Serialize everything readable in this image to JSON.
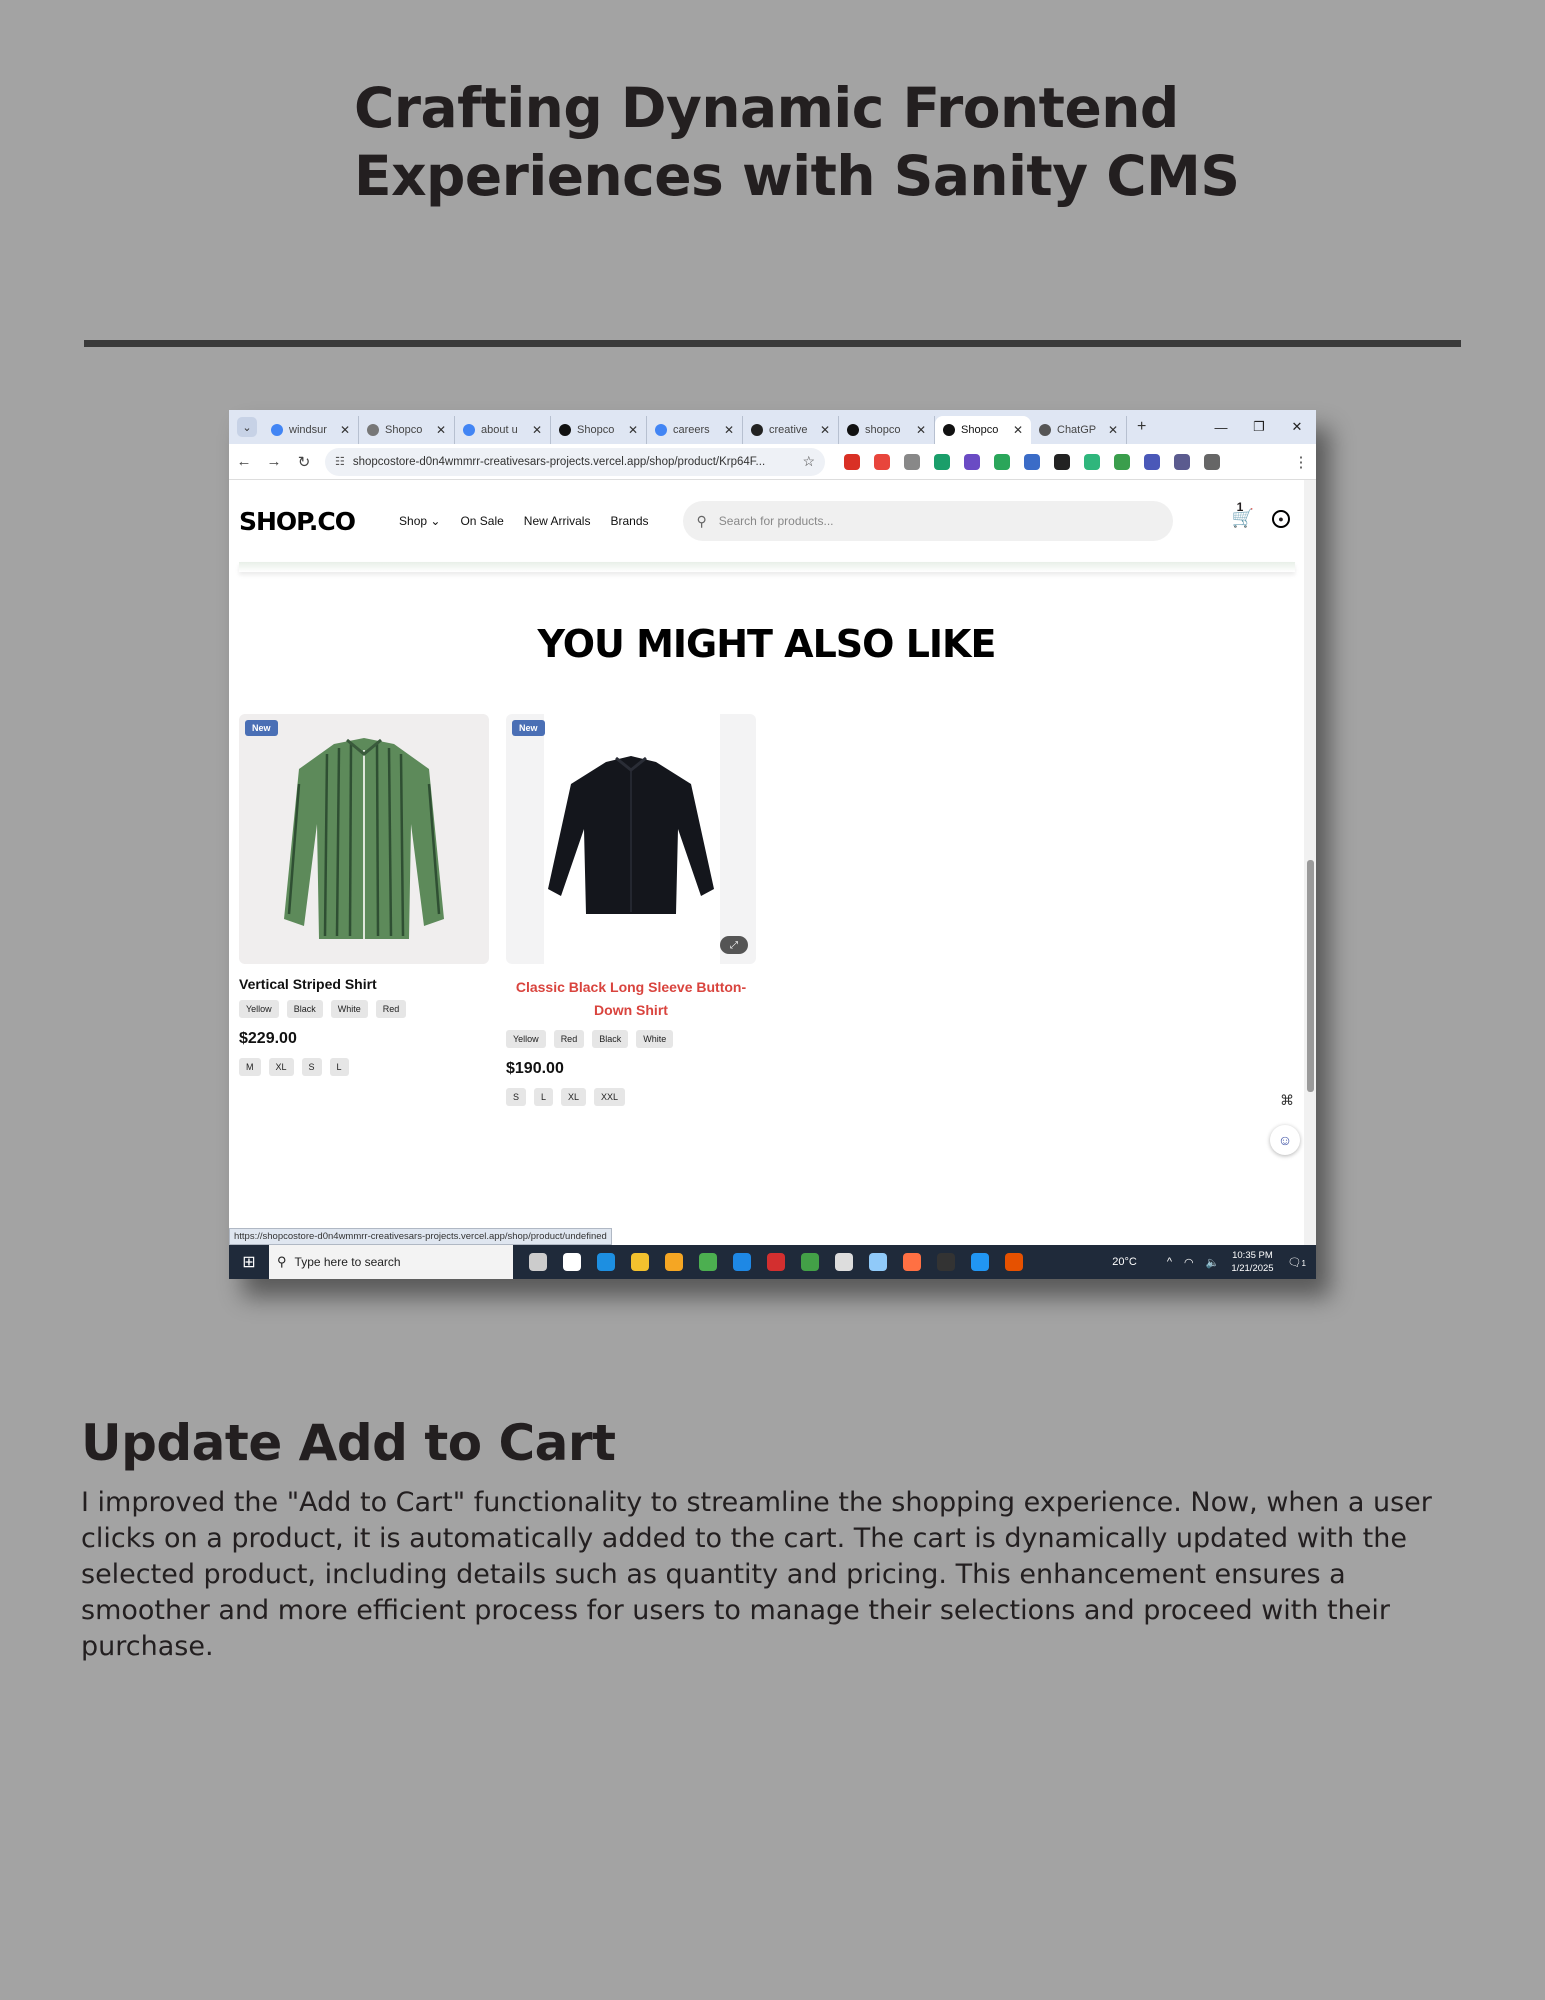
{
  "document": {
    "title_line1": "Crafting Dynamic Frontend",
    "title_line2": "Experiences with Sanity CMS",
    "section_heading": "Update Add to Cart",
    "paragraph": "I improved the \"Add to Cart\" functionality to streamline the shopping experience. Now, when a user clicks on a product, it is automatically added to the cart. The cart is dynamically updated with the selected product, including details such as quantity and pricing. This enhancement ensures a smoother and more efficient process for users to manage their selections and proceed with their purchase."
  },
  "browser": {
    "tabs": [
      {
        "label": "windsur",
        "favicon": "google-icon",
        "color": "#4285f4"
      },
      {
        "label": "Shopco",
        "favicon": "globe-icon",
        "color": "#777777"
      },
      {
        "label": "about u",
        "favicon": "google-icon",
        "color": "#4285f4"
      },
      {
        "label": "Shopco",
        "favicon": "vercel-icon",
        "color": "#111111"
      },
      {
        "label": "careers",
        "favicon": "google-icon",
        "color": "#4285f4"
      },
      {
        "label": "creative",
        "favicon": "github-icon",
        "color": "#222222"
      },
      {
        "label": "shopco",
        "favicon": "vercel-icon",
        "color": "#111111"
      },
      {
        "label": "Shopco",
        "favicon": "vercel-icon",
        "color": "#111111",
        "active": true
      },
      {
        "label": "ChatGP",
        "favicon": "openai-icon",
        "color": "#555555"
      }
    ],
    "new_tab": "+",
    "url": "shopcostore-d0n4wmmrr-creativesars-projects.vercel.app/shop/product/Krp64F...",
    "status_url": "https://shopcostore-d0n4wmmrr-creativesars-projects.vercel.app/shop/product/undefined",
    "extension_colors": [
      "#d93025",
      "#e8453c",
      "#888888",
      "#1a9e6a",
      "#6a4bc4",
      "#2aa65a",
      "#3b6cc7",
      "#222222",
      "#2fb67c",
      "#3a9e4c",
      "#4a58b8",
      "#5b5b8f",
      "#666666"
    ]
  },
  "site": {
    "logo": "SHOP.CO",
    "nav": [
      "Shop ⌄",
      "On Sale",
      "New Arrivals",
      "Brands"
    ],
    "search_placeholder": "Search for products...",
    "cart_count": "1",
    "section_title": "YOU MIGHT ALSO LIKE",
    "products": [
      {
        "badge": "New",
        "name": "Vertical Striped Shirt",
        "colors": [
          "Yellow",
          "Black",
          "White",
          "Red"
        ],
        "price": "$229.00",
        "sizes": [
          "M",
          "XL",
          "S",
          "L"
        ]
      },
      {
        "badge": "New",
        "name": "Classic Black Long Sleeve Button-Down Shirt",
        "colors": [
          "Yellow",
          "Red",
          "Black",
          "White"
        ],
        "price": "$190.00",
        "sizes": [
          "S",
          "L",
          "XL",
          "XXL"
        ]
      }
    ]
  },
  "taskbar": {
    "search_placeholder": "Type here to search",
    "temperature": "20°C",
    "time": "10:35 PM",
    "date": "1/21/2025",
    "notification_count": "1",
    "app_colors": [
      "#cccccc",
      "#ffffff",
      "#1d8fe1",
      "#f2c12e",
      "#f5a623",
      "#4caf50",
      "#1e88e5",
      "#d32f2f",
      "#43a047",
      "#dddddd",
      "#90caf9",
      "#ff7043",
      "#333333",
      "#2196f3",
      "#e65100"
    ]
  }
}
